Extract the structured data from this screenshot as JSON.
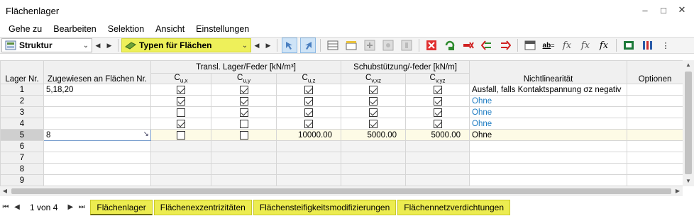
{
  "window": {
    "title": "Flächenlager"
  },
  "menu": [
    "Gehe zu",
    "Bearbeiten",
    "Selektion",
    "Ansicht",
    "Einstellungen"
  ],
  "toolbar": {
    "nav_combo": "Struktur",
    "type_combo": "Typen für Flächen"
  },
  "table": {
    "headers": {
      "lager": "Lager Nr.",
      "zugewiesen": "Zugewiesen an Flächen Nr.",
      "transl": "Transl. Lager/Feder [kN/m³]",
      "schub": "Schubstützung/-feder [kN/m]",
      "nichtlin": "Nichtlinearität",
      "optionen": "Optionen",
      "cux": "Cu,x",
      "cuy": "Cu,y",
      "cuz": "Cu,z",
      "cvxz": "Cv,xz",
      "cvyz": "Cv,yz"
    },
    "rows": [
      {
        "nr": "1",
        "flaechen": "5,18,20",
        "cux": true,
        "cuy": true,
        "cuz": true,
        "cvxz": true,
        "cvyz": true,
        "nichtlin": "Ausfall, falls Kontaktspannung σz negativ"
      },
      {
        "nr": "2",
        "flaechen": "",
        "cux": true,
        "cuy": true,
        "cuz": true,
        "cvxz": true,
        "cvyz": true,
        "nichtlin": "Ohne"
      },
      {
        "nr": "3",
        "flaechen": "",
        "cux": false,
        "cuy": true,
        "cuz": true,
        "cvxz": true,
        "cvyz": true,
        "nichtlin": "Ohne"
      },
      {
        "nr": "4",
        "flaechen": "",
        "cux": true,
        "cuy": false,
        "cuz": true,
        "cvxz": true,
        "cvyz": true,
        "nichtlin": "Ohne"
      },
      {
        "nr": "5",
        "flaechen": "8",
        "cux": false,
        "cuy": false,
        "cuz_value": "10000.00",
        "cvxz_value": "5000.00",
        "cvyz_value": "5000.00",
        "nichtlin": "Ohne"
      },
      {
        "nr": "6"
      },
      {
        "nr": "7"
      },
      {
        "nr": "8"
      },
      {
        "nr": "9"
      }
    ]
  },
  "status": {
    "pager": "1 von 4",
    "tabs": [
      "Flächenlager",
      "Flächenexzentrizitäten",
      "Flächensteifigkeitsmodifizierungen",
      "Flächennetzverdichtungen"
    ]
  }
}
